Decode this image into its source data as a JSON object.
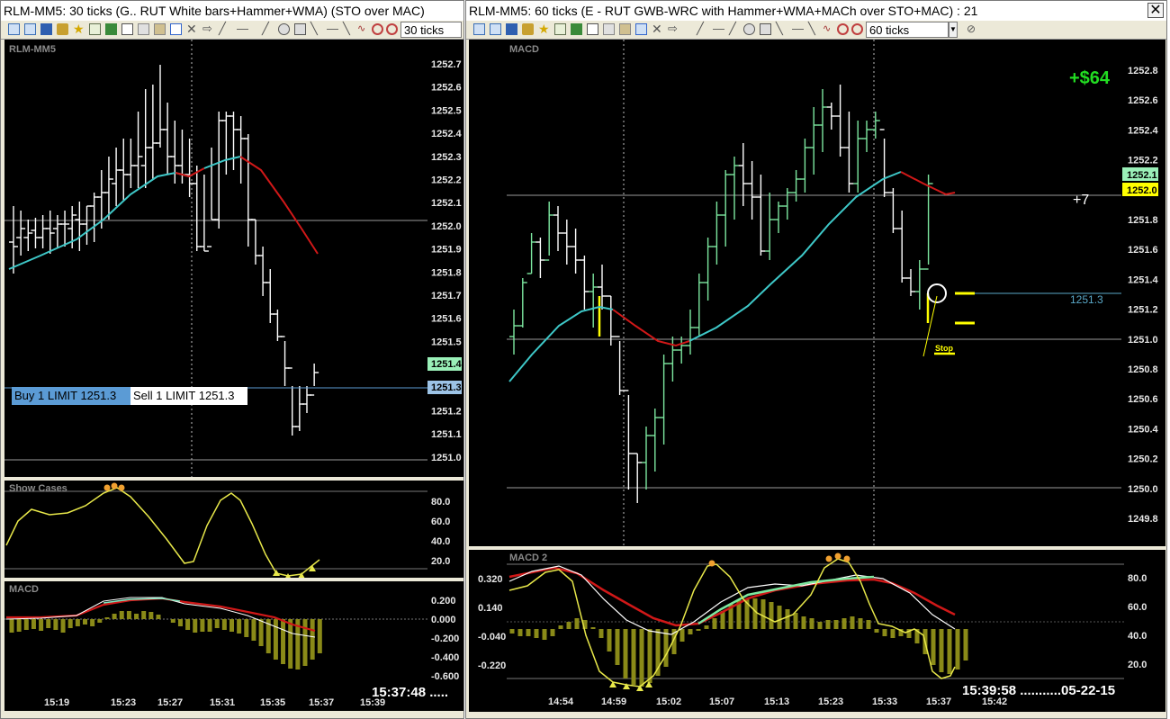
{
  "left_window": {
    "title": "RLM-MM5: 30 ticks (G.. RUT  White bars+Hammer+WMA) (STO over MAC)",
    "interval": "30 ticks",
    "price_panel": {
      "label": "RLM-MM5",
      "y_ticks": [
        "1252.7",
        "1252.6",
        "1252.5",
        "1252.4",
        "1252.3",
        "1252.2",
        "1252.1",
        "1252.0",
        "1251.9",
        "1251.8",
        "1251.7",
        "1251.6",
        "1251.5",
        "1251.4",
        "1251.3",
        "1251.2",
        "1251.1",
        "1251.0"
      ],
      "last_price_tag": "1251.4",
      "order_price_tag": "1251.3",
      "buy_order": "Buy 1 LIMIT 1251.3",
      "sell_order": "Sell 1 LIMIT 1251.3"
    },
    "stochastic_panel": {
      "label": "Show Cases",
      "y_ticks": [
        "80.0",
        "60.0",
        "40.0",
        "20.0"
      ]
    },
    "macd_panel": {
      "label": "MACD",
      "y_ticks": [
        "0.200",
        "0.000",
        "-0.200",
        "-0.400",
        "-0.600"
      ]
    },
    "x_ticks": [
      "15:19",
      "15:23",
      "15:27",
      "15:31",
      "15:35",
      "15:37",
      "15:39"
    ],
    "clock": "15:37:48 ....."
  },
  "right_window": {
    "title": "RLM-MM5: 60 ticks (E - RUT  GWB-WRC with Hammer+WMA+MACh  over STO+MAC) : 21",
    "interval": "60 ticks",
    "price_panel": {
      "label": "MACD",
      "y_ticks": [
        "1252.8",
        "1252.6",
        "1252.4",
        "1252.2",
        "1252.0",
        "1251.8",
        "1251.6",
        "1251.4",
        "1251.2",
        "1251.0",
        "1250.8",
        "1250.6",
        "1250.4",
        "1250.2",
        "1250.0",
        "1249.8"
      ],
      "profit_label": "+$64",
      "ticks_label": "+7",
      "tag_upper": "1252.1",
      "tag_lower": "1252.0",
      "entry_level": "1251.3",
      "stop_label": "Stop"
    },
    "lower_panel": {
      "label": "MACD 2",
      "left_ticks": [
        "0.320",
        "0.140",
        "-0.040",
        "-0.220"
      ],
      "right_ticks": [
        "80.0",
        "60.0",
        "40.0",
        "20.0"
      ]
    },
    "x_ticks": [
      "14:54",
      "14:59",
      "15:02",
      "15:07",
      "15:13",
      "15:23",
      "15:33",
      "15:37",
      "15:42"
    ],
    "clock": "15:39:58 ...........05-22-15"
  },
  "colors": {
    "background": "#000000",
    "up_bar": "#7de8a0",
    "down_bar": "#ffffff",
    "ma_rising": "#3ec8c8",
    "ma_falling": "#d01818",
    "stochastic": "#e8e84a",
    "histogram": "#8a8a18",
    "order_line": "#5b9bd5",
    "profit": "#22dd22",
    "tag_green": "#9af0b8",
    "tag_yellow": "#ffff00"
  },
  "icons": [
    "cursor-icon",
    "select-icon",
    "save-icon",
    "print-icon",
    "drawing-tools-icon",
    "favorite-icon",
    "data-window-icon",
    "indicator-icon",
    "copy-icon",
    "paste-icon",
    "grid-icon",
    "close-icon",
    "arrow-icon",
    "line-icon",
    "ellipse-icon",
    "rectangle-icon",
    "ray-icon",
    "zoom-in-icon",
    "zoom-out-icon"
  ]
}
